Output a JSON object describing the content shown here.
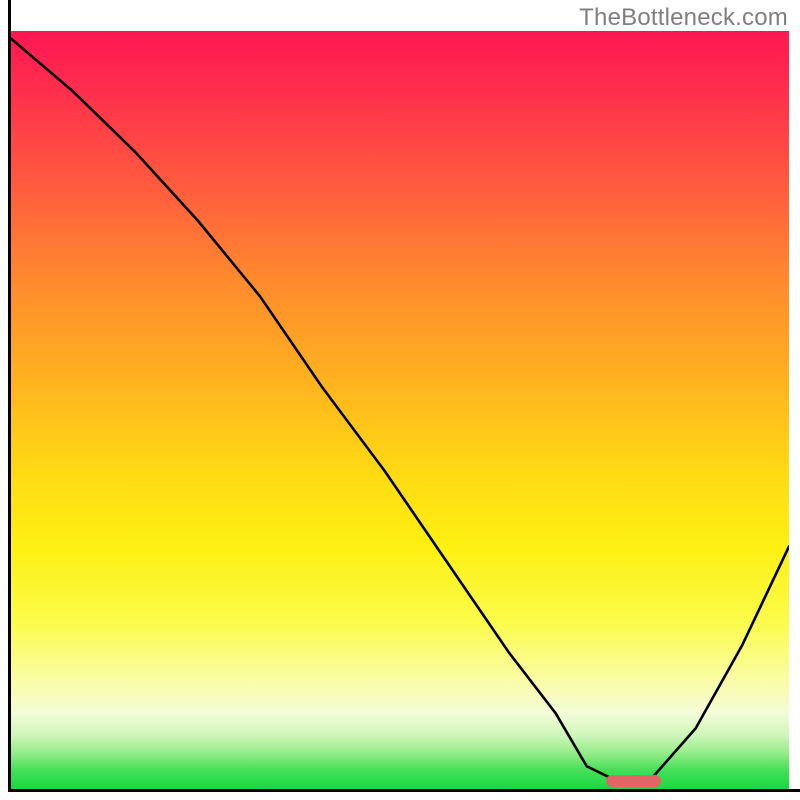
{
  "watermark": "TheBottleneck.com",
  "chart_data": {
    "type": "line",
    "title": "",
    "xlabel": "",
    "ylabel": "",
    "xlim": [
      0,
      100
    ],
    "ylim": [
      0,
      100
    ],
    "grid": false,
    "legend": false,
    "description": "Bottleneck curve over a vertical red-to-green gradient. The black line descends from top-left, flattens briefly near the bottom (optimum), then rises toward the right edge.",
    "x": [
      0,
      8,
      16,
      24,
      32,
      40,
      48,
      56,
      64,
      70,
      74,
      78,
      82,
      88,
      94,
      100
    ],
    "y": [
      99,
      92,
      84,
      75,
      65,
      53,
      42,
      30,
      18,
      10,
      3,
      1,
      1,
      8,
      19,
      32
    ],
    "marker": {
      "x_center": 80,
      "width_pct": 7,
      "y": 1,
      "color": "#e06666"
    },
    "gradient_colors": {
      "top": "#ff1752",
      "mid": "#ffd914",
      "bottom": "#18d93f"
    }
  }
}
